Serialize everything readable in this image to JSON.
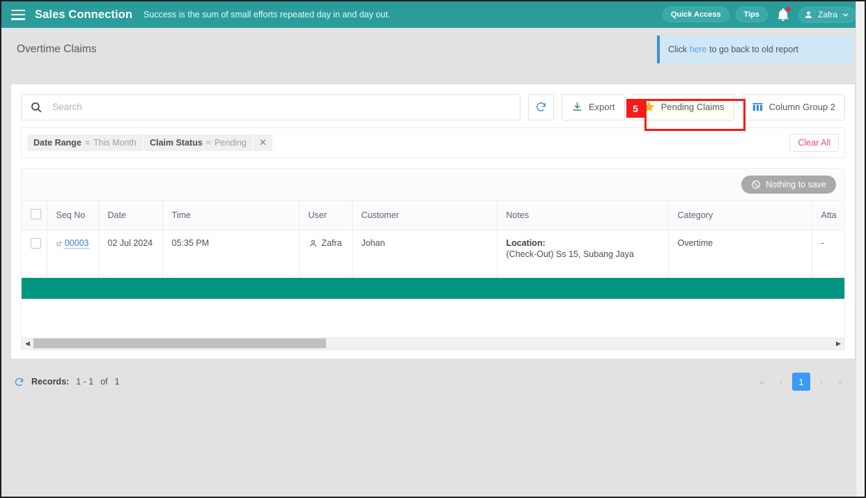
{
  "topbar": {
    "menu_icon": "hamburger-icon",
    "brand": "Sales Connection",
    "tagline": "Success is the sum of small efforts repeated day in and day out.",
    "quick_access_label": "Quick Access",
    "tips_label": "Tips",
    "bell_icon": "notification-bell-icon",
    "user_name": "Zafra",
    "brand_color": "#2a9d9b"
  },
  "page": {
    "title": "Overtime Claims",
    "notice_prefix": "Click",
    "notice_link": "here",
    "notice_suffix": "to go back to old report"
  },
  "toolbar": {
    "search_placeholder": "Search",
    "search_value": "",
    "refresh_label": "",
    "export_label": "Export",
    "pending_claims_label": "Pending Claims",
    "column_group_label": "Column Group 2"
  },
  "annotation": {
    "number": "5"
  },
  "filters": {
    "chips": [
      {
        "key": "Date Range",
        "op": "=",
        "value": "This Month"
      },
      {
        "key": "Claim Status",
        "op": "=",
        "value": "Pending"
      }
    ],
    "remove_label": "✕",
    "clear_all_label": "Clear All"
  },
  "grid": {
    "save_button_label": "Nothing to save",
    "save_button_icon": "no-entry-icon",
    "columns": [
      "",
      "Seq No",
      "Date",
      "Time",
      "User",
      "Customer",
      "Notes",
      "Category",
      "Atta"
    ],
    "rows": [
      {
        "seq_no": "00003",
        "date": "02 Jul 2024",
        "time": "05:35 PM",
        "user": "Zafra",
        "customer": "Johan",
        "notes_label": "Location:",
        "notes_text": "(Check-Out) Ss 15, Subang Jaya",
        "category": "Overtime",
        "attachment": "-"
      }
    ],
    "summary_bar_color": "#00957f"
  },
  "pagination": {
    "refresh_icon": "refresh-icon",
    "records_label": "Records:",
    "range": "1 - 1",
    "of_label": "of",
    "total": "1",
    "first_label": "«",
    "prev_label": "‹",
    "current_page": "1",
    "next_label": "›",
    "last_label": "»"
  }
}
